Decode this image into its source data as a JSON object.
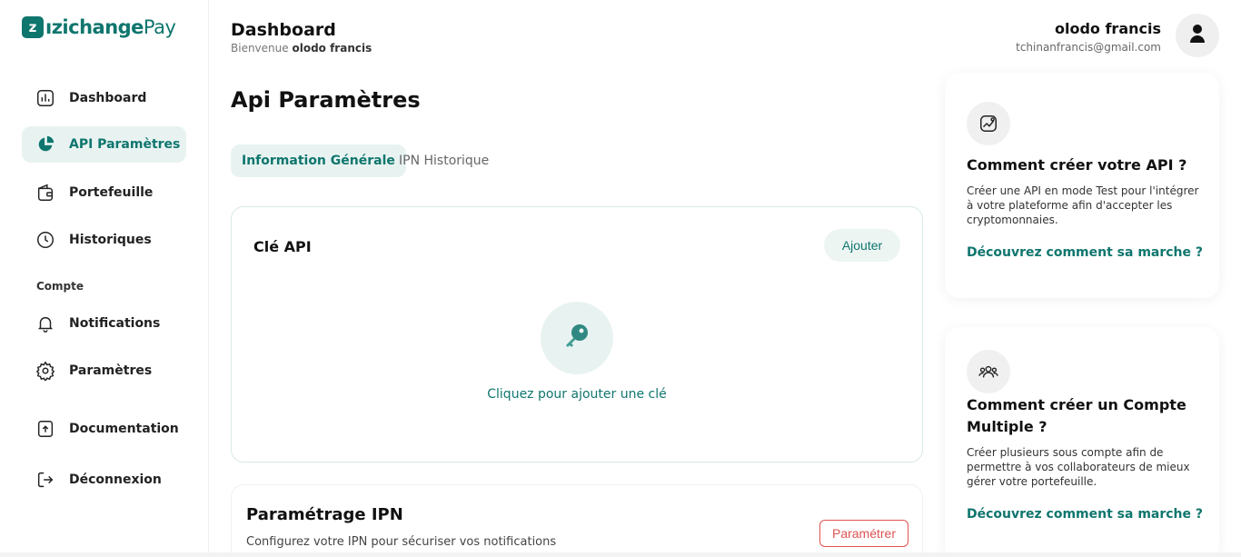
{
  "brand": {
    "badge": "z",
    "name": "ızichange",
    "suffix": "Pay",
    "color": "#0f766e"
  },
  "sidebar": {
    "items": [
      {
        "label": "Dashboard",
        "icon": "bar-chart-icon"
      },
      {
        "label": "API Paramètres",
        "icon": "pie-chart-icon",
        "active": true
      },
      {
        "label": "Portefeuille",
        "icon": "wallet-icon"
      },
      {
        "label": "Historiques",
        "icon": "clock-icon"
      }
    ],
    "section_label": "Compte",
    "account_items": [
      {
        "label": "Notifications",
        "icon": "bell-icon"
      },
      {
        "label": "Paramètres",
        "icon": "gear-icon"
      },
      {
        "label": "Documentation",
        "icon": "document-upload-icon"
      },
      {
        "label": "Déconnexion",
        "icon": "logout-icon"
      }
    ]
  },
  "header": {
    "title": "Dashboard",
    "welcome": "Bienvenue",
    "welcome_name": "olodo francis",
    "user_name": "olodo francis",
    "user_email": "tchinanfrancis@gmail.com"
  },
  "main": {
    "page_title": "Api Paramètres",
    "tabs": [
      {
        "label": "Information Générale",
        "active": true
      },
      {
        "label": "IPN Historique",
        "active": false
      }
    ],
    "api_card": {
      "title": "Clé API",
      "add_button": "Ajouter",
      "empty_link": "Cliquez pour ajouter une clé"
    },
    "ipn_card": {
      "title": "Paramétrage IPN",
      "description": "Configurez votre IPN pour sécuriser vos notifications",
      "button": "Paramétrer"
    }
  },
  "help": [
    {
      "title": "Comment créer votre API ?",
      "description": "Créer une API en mode Test pour l'intégrer à votre plateforme afin d'accepter les cryptomonnaies.",
      "link": "Découvrez comment sa marche ?",
      "icon": "api-chart-icon"
    },
    {
      "title": "Comment créer un Compte Multiple ?",
      "description": "Créer plusieurs sous compte afin de permettre à vos collaborateurs de mieux gérer votre portefeuille.",
      "link": "Découvrez comment sa marche ?",
      "icon": "users-group-icon"
    }
  ],
  "colors": {
    "accent": "#0f766e",
    "accent_bg": "#e8f3f1",
    "danger": "#e05252"
  }
}
